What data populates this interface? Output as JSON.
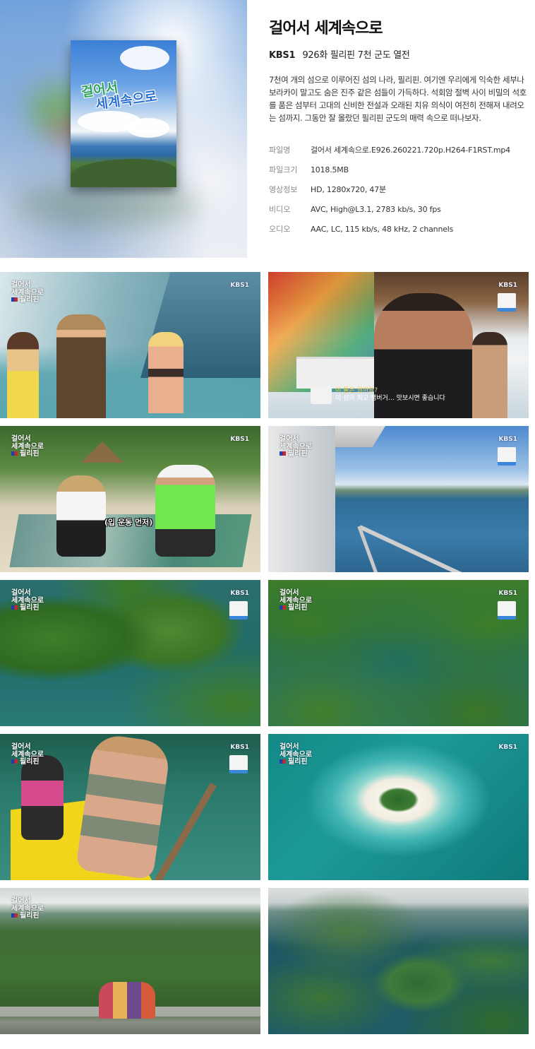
{
  "program": {
    "title": "걸어서 세계속으로",
    "channel": "KBS1",
    "episode": "926화 필리핀 7천 군도 열전",
    "description": "7천여 개의 섬으로 이루어진 섬의 나라, 필리핀. 여기엔 우리에게 익숙한 세부나 보라카이 말고도 숨은 진주 같은 섬들이 가득하다. 석회암 절벽 사이 비밀의 석호를 품은 섬부터 고대의 신비한 전설과 오래된 치유 의식이 여전히 전해져 내려오는 섬까지. 그동안 잘 몰랐던 필리핀 군도의 매력 속으로 떠나보자.",
    "poster_logo_line1": "걸어서",
    "poster_logo_line2": "세계속으로"
  },
  "file_info": [
    {
      "key": "파일명",
      "value": "걸어서 세계속으로.E926.260221.720p.H264-F1RST.mp4"
    },
    {
      "key": "파일크기",
      "value": "1018.5MB"
    },
    {
      "key": "영상정보",
      "value": "HD, 1280x720, 47분"
    },
    {
      "key": "비디오",
      "value": "AVC, High@L3.1, 2783 kb/s, 30 fps"
    },
    {
      "key": "오디오",
      "value": "AAC, LC, 115 kb/s, 48 kHz, 2 channels"
    }
  ],
  "overlay": {
    "logo_line1": "걸어서",
    "logo_line2": "세계속으로",
    "country": "필리핀",
    "kbs": "KBS1"
  },
  "screenshots": {
    "s2_sub_line1": "이 물은 뭘까요?",
    "s2_sub_line2": "이 섬의 최고 램버거… 맛보시면 좋습니다",
    "s3_caption": "(입 운동 먼저)"
  },
  "colors": {
    "accent_blue": "#3a86d8",
    "title_text": "#111111",
    "meta_key": "#888888"
  }
}
